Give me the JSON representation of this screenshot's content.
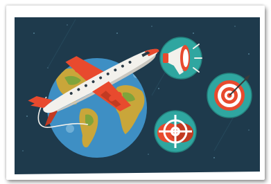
{
  "image": {
    "kind": "illustration",
    "subject_icons": [
      "globe-icon",
      "airplane-icon",
      "megaphone-icon",
      "target-icon",
      "crosshair-target-icon"
    ],
    "colors": {
      "background": "#1e3a4c",
      "frame": "#ffffff",
      "ocean": "#3e8fc4",
      "land": "#c9a63a",
      "land_green": "#7fa43b",
      "plane_body": "#f3f1ec",
      "plane_accent": "#e84a2e",
      "badge_teal": "#2fa6a0",
      "target_red": "#e84a2e"
    }
  }
}
